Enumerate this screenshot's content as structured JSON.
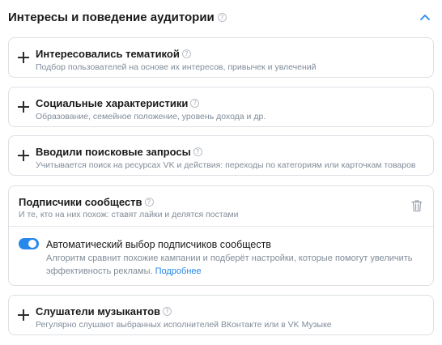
{
  "section": {
    "title": "Интересы и поведение аудитории",
    "help_icon": "question-circle-icon",
    "collapse_icon": "chevron-up-icon"
  },
  "cards": [
    {
      "title": "Интересовались тематикой",
      "subtitle": "Подбор пользователей на основе их интересов, привычек и увлечений",
      "icon": "plus-icon"
    },
    {
      "title": "Социальные характеристики",
      "subtitle": "Образование, семейное положение, уровень дохода и др.",
      "icon": "plus-icon"
    },
    {
      "title": "Вводили поисковые запросы",
      "subtitle": "Учитывается поиск на ресурсах VK и действия: переходы по категориям или карточкам товаров",
      "icon": "plus-icon"
    }
  ],
  "expanded": {
    "title": "Подписчики сообществ",
    "subtitle": "И те, кто на них похож: ставят лайки и делятся постами",
    "delete_icon": "trash-icon",
    "toggle": {
      "label": "Автоматический выбор подписчиков сообществ",
      "checked": true,
      "description": "Алгоритм сравнит похожие кампании и подберёт настройки, которые помогут увеличить эффективность рекламы.",
      "link_text": "Подробнее"
    }
  },
  "last_card": {
    "title": "Слушатели музыкантов",
    "subtitle": "Регулярно слушают выбранных исполнителей ВКонтакте или в VK Музыке",
    "icon": "plus-icon"
  },
  "colors": {
    "accent": "#2688eb",
    "secondary_text": "#818c99",
    "border": "#dce1e6"
  }
}
